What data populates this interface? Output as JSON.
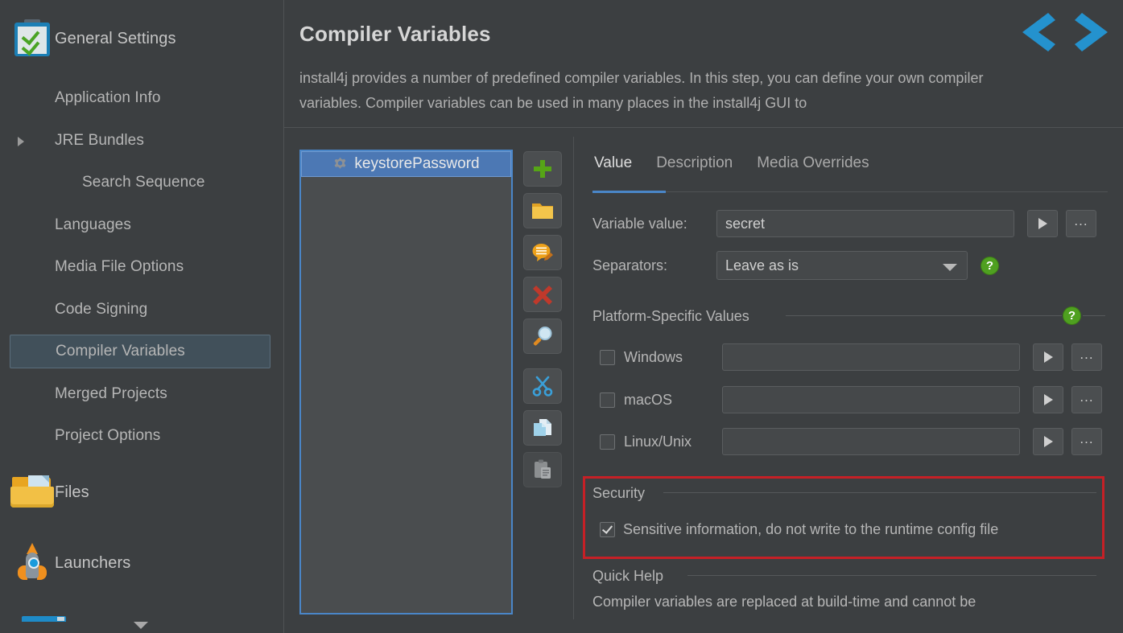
{
  "sidebar": {
    "header": {
      "label": "General Settings",
      "icon": "clipboard-checklist-icon"
    },
    "items": [
      {
        "label": "Application Info",
        "level": 1
      },
      {
        "label": "JRE Bundles",
        "level": 1,
        "expanded": true
      },
      {
        "label": "Search Sequence",
        "level": 2
      },
      {
        "label": "Languages",
        "level": 1
      },
      {
        "label": "Media File Options",
        "level": 1
      },
      {
        "label": "Code Signing",
        "level": 1
      },
      {
        "label": "Compiler Variables",
        "level": 1,
        "selected": true
      },
      {
        "label": "Merged Projects",
        "level": 1
      },
      {
        "label": "Project Options",
        "level": 1
      }
    ],
    "groups": [
      {
        "label": "Files",
        "icon": "folder-file-icon"
      },
      {
        "label": "Launchers",
        "icon": "rocket-icon"
      }
    ],
    "scroll_down_icon": "chevron-down-icon"
  },
  "header": {
    "title": "Compiler Variables",
    "description": "install4j provides a number of predefined compiler variables. In this step, you can define your own compiler variables. Compiler variables can be used in many places in the install4j GUI to",
    "nav_prev_icon": "chevron-left-icon",
    "nav_next_icon": "chevron-right-icon"
  },
  "list": {
    "items": [
      {
        "label": "keystorePassword",
        "icon": "gear-icon",
        "selected": true
      }
    ]
  },
  "toolbar": {
    "buttons": [
      {
        "name": "add-button",
        "icon": "green-plus-icon"
      },
      {
        "name": "open-folder-button",
        "icon": "yellow-folder-icon"
      },
      {
        "name": "edit-comment-button",
        "icon": "orange-speech-bubble-icon"
      },
      {
        "name": "delete-button",
        "icon": "red-x-icon"
      },
      {
        "name": "find-button",
        "icon": "magnifier-icon"
      },
      {
        "name": "cut-button",
        "icon": "scissors-icon"
      },
      {
        "name": "copy-button",
        "icon": "copy-pages-icon"
      },
      {
        "name": "paste-button",
        "icon": "clipboard-paste-icon"
      }
    ]
  },
  "detail": {
    "tabs": [
      {
        "label": "Value",
        "active": true
      },
      {
        "label": "Description",
        "active": false
      },
      {
        "label": "Media Overrides",
        "active": false
      }
    ],
    "variable_value": {
      "label": "Variable value:",
      "value": "secret",
      "play_button": "▶",
      "ellipsis_button": "..."
    },
    "separators": {
      "label": "Separators:",
      "value": "Leave as is",
      "options": [
        "Leave as is"
      ],
      "help_icon": "?"
    },
    "platform_section": {
      "title": "Platform-Specific Values",
      "help_icon": "?",
      "rows": [
        {
          "label": "Windows",
          "checked": false,
          "value": ""
        },
        {
          "label": "macOS",
          "checked": false,
          "value": ""
        },
        {
          "label": "Linux/Unix",
          "checked": false,
          "value": ""
        }
      ],
      "play_button": "▶",
      "ellipsis_button": "..."
    },
    "security_section": {
      "title": "Security",
      "checkbox_label": "Sensitive information, do not write to the runtime config file",
      "checked": true,
      "highlight_color": "#c62026"
    },
    "quick_help_section": {
      "title": "Quick Help",
      "text": "Compiler variables are replaced at build-time and cannot be"
    }
  },
  "colors": {
    "background": "#3c3f41",
    "accent_blue": "#4a86c8",
    "selection_blue": "#4c78b4",
    "highlight_red": "#c62026",
    "help_green": "#4fa020"
  }
}
